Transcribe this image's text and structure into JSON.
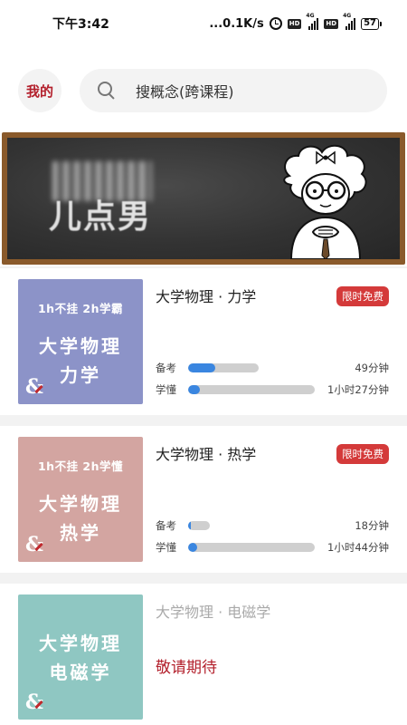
{
  "status_bar": {
    "time": "下午3:42",
    "network_speed": "...0.1K/s",
    "alarm_icon": "alarm-clock-icon",
    "hd_label": "HD",
    "net_type": "4G",
    "battery": "57"
  },
  "header": {
    "my_label": "我的",
    "search_icon": "search-icon",
    "search_placeholder": "搜概念(跨课程)"
  },
  "banner": {
    "chalk_text": "儿点男",
    "illustration": "cartoon-professor"
  },
  "courses": [
    {
      "cover_subtitle": "1h不挂  2h学霸",
      "cover_line1": "大学物理",
      "cover_line2": "力学",
      "cover_color": "#8c93c8",
      "title": "大学物理 · 力学",
      "badge": "限时免费",
      "progress": [
        {
          "label": "备考",
          "value": "49分钟",
          "fraction": 0.38
        },
        {
          "label": "学懂",
          "value": "1小时27分钟",
          "fraction": 0.09
        }
      ]
    },
    {
      "cover_subtitle": "1h不挂  2h学懂",
      "cover_line1": "大学物理",
      "cover_line2": "热学",
      "cover_color": "#d3a5a1",
      "title": "大学物理 · 热学",
      "badge": "限时免费",
      "progress": [
        {
          "label": "备考",
          "value": "18分钟",
          "fraction": 0.12
        },
        {
          "label": "学懂",
          "value": "1小时44分钟",
          "fraction": 0.07
        }
      ]
    },
    {
      "cover_line1": "大学物理",
      "cover_line2": "电磁学",
      "cover_color": "#8fc7c2",
      "title": "大学物理 · 电磁学",
      "status": "敬请期待"
    }
  ],
  "colors": {
    "accent_red": "#b3202c",
    "badge_red": "#d43a3a",
    "progress_blue": "#3a86e0"
  }
}
